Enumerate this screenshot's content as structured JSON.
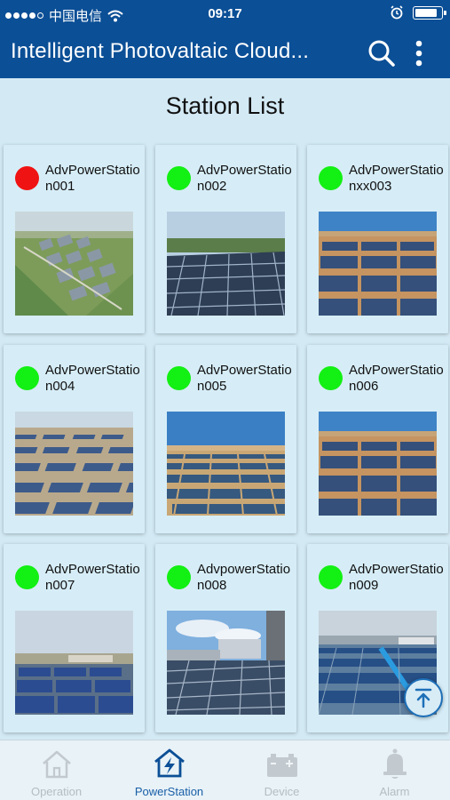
{
  "status_bar": {
    "carrier": "中国电信",
    "time": "09:17"
  },
  "header": {
    "title": "Intelligent Photovaltaic Cloud..."
  },
  "page": {
    "title": "Station List"
  },
  "colors": {
    "primary": "#0b4f96",
    "online": "#13f013",
    "offline": "#f01313",
    "background": "#d3eaf5"
  },
  "stations": [
    {
      "name": "AdvPowerStation001",
      "status": "offline",
      "photo": "aerial-campus"
    },
    {
      "name": "AdvPowerStation002",
      "status": "online",
      "photo": "rooftop-panels"
    },
    {
      "name": "AdvPowerStationxx003",
      "status": "online",
      "photo": "desert-farm"
    },
    {
      "name": "AdvPowerStation004",
      "status": "online",
      "photo": "field-rows"
    },
    {
      "name": "AdvPowerStation005",
      "status": "online",
      "photo": "desert-rows"
    },
    {
      "name": "AdvPowerStation006",
      "status": "online",
      "photo": "desert-farm"
    },
    {
      "name": "AdvPowerStation007",
      "status": "online",
      "photo": "ground-panels"
    },
    {
      "name": "AdvpowerStation008",
      "status": "online",
      "photo": "city-rooftop"
    },
    {
      "name": "AdvPowerStation009",
      "status": "online",
      "photo": "factory-roof"
    }
  ],
  "tabs": [
    {
      "label": "Operation",
      "icon": "home-icon",
      "active": false
    },
    {
      "label": "PowerStation",
      "icon": "powerstation-icon",
      "active": true
    },
    {
      "label": "Device",
      "icon": "battery-icon",
      "active": false
    },
    {
      "label": "Alarm",
      "icon": "bell-icon",
      "active": false
    }
  ]
}
